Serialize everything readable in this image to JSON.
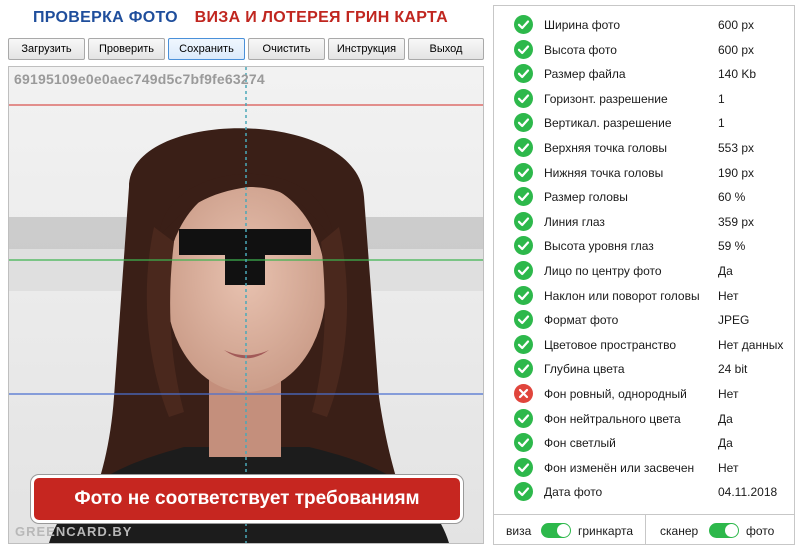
{
  "header": {
    "title_part1": "ПРОВЕРКА ФОТО",
    "title_part2": "ВИЗА И ЛОТЕРЕЯ ГРИН КАРТА"
  },
  "toolbar": {
    "load_label": "Загрузить",
    "check_label": "Проверить",
    "save_label": "Сохранить",
    "clear_label": "Очистить",
    "instruction_label": "Инструкция",
    "exit_label": "Выход"
  },
  "photo": {
    "hash": "69195109e0e0aec749d5c7bf9fe63274",
    "watermark": "GREENCARD.BY",
    "verdict": "Фото не соответствует требованиям"
  },
  "checks": [
    {
      "label": "Ширина фото",
      "value": "600 px",
      "status": "ok"
    },
    {
      "label": "Высота фото",
      "value": "600 px",
      "status": "ok"
    },
    {
      "label": "Размер файла",
      "value": "140 Kb",
      "status": "ok"
    },
    {
      "label": "Горизонт. разрешение",
      "value": "1",
      "status": "ok"
    },
    {
      "label": "Вертикал. разрешение",
      "value": "1",
      "status": "ok"
    },
    {
      "label": "Верхняя точка головы",
      "value": "553 px",
      "status": "ok"
    },
    {
      "label": "Нижняя точка головы",
      "value": "190 px",
      "status": "ok"
    },
    {
      "label": "Размер головы",
      "value": "60 %",
      "status": "ok"
    },
    {
      "label": "Линия глаз",
      "value": "359 px",
      "status": "ok"
    },
    {
      "label": "Высота уровня глаз",
      "value": "59 %",
      "status": "ok"
    },
    {
      "label": "Лицо по центру фото",
      "value": "Да",
      "status": "ok"
    },
    {
      "label": "Наклон или поворот головы",
      "value": "Нет",
      "status": "ok"
    },
    {
      "label": "Формат фото",
      "value": "JPEG",
      "status": "ok"
    },
    {
      "label": "Цветовое пространство",
      "value": "Нет данных",
      "status": "ok"
    },
    {
      "label": "Глубина цвета",
      "value": "24 bit",
      "status": "ok"
    },
    {
      "label": "Фон ровный, однородный",
      "value": "Нет",
      "status": "fail"
    },
    {
      "label": "Фон нейтрального цвета",
      "value": "Да",
      "status": "ok"
    },
    {
      "label": "Фон светлый",
      "value": "Да",
      "status": "ok"
    },
    {
      "label": "Фон изменён или засвечен",
      "value": "Нет",
      "status": "ok"
    },
    {
      "label": "Дата фото",
      "value": "04.11.2018",
      "status": "ok"
    }
  ],
  "footer": {
    "left_off": "виза",
    "left_on": "гринкарта",
    "right_off": "сканер",
    "right_on": "фото"
  },
  "colors": {
    "ok": "#2db84b",
    "fail": "#e0453c",
    "accent": "#4a90d9"
  }
}
